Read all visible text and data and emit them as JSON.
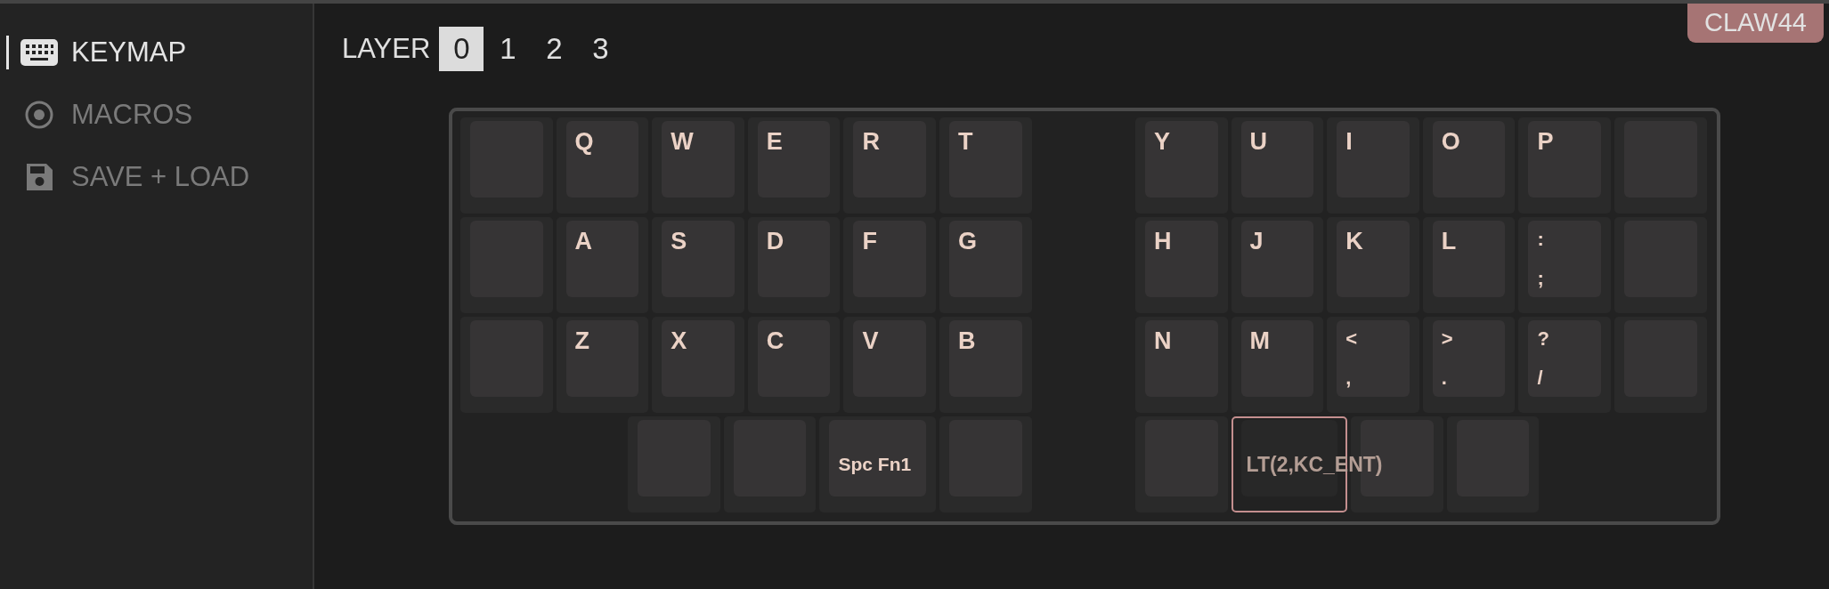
{
  "sidebar": {
    "items": [
      {
        "label": "KEYMAP",
        "selected": true
      },
      {
        "label": "MACROS",
        "selected": false
      },
      {
        "label": "SAVE + LOAD",
        "selected": false
      }
    ]
  },
  "layers": {
    "label": "LAYER",
    "tabs": [
      {
        "label": "0",
        "selected": true
      },
      {
        "label": "1",
        "selected": false
      },
      {
        "label": "2",
        "selected": false
      },
      {
        "label": "3",
        "selected": false
      }
    ]
  },
  "badge": "CLAW44",
  "keyboard": {
    "halves": [
      {
        "rows": [
          [
            {
              "kind": "blank",
              "selected": false
            },
            {
              "kind": "legend",
              "legends": [
                "Q"
              ],
              "selected": false
            },
            {
              "kind": "legend",
              "legends": [
                "W"
              ],
              "selected": false
            },
            {
              "kind": "legend",
              "legends": [
                "E"
              ],
              "selected": false
            },
            {
              "kind": "legend",
              "legends": [
                "R"
              ],
              "selected": false
            },
            {
              "kind": "legend",
              "legends": [
                "T"
              ],
              "selected": false
            }
          ],
          [
            {
              "kind": "blank",
              "selected": false
            },
            {
              "kind": "legend",
              "legends": [
                "A"
              ],
              "selected": false
            },
            {
              "kind": "legend",
              "legends": [
                "S"
              ],
              "selected": false
            },
            {
              "kind": "legend",
              "legends": [
                "D"
              ],
              "selected": false
            },
            {
              "kind": "legend",
              "legends": [
                "F"
              ],
              "selected": false
            },
            {
              "kind": "legend",
              "legends": [
                "G"
              ],
              "selected": false
            }
          ],
          [
            {
              "kind": "blank",
              "selected": false
            },
            {
              "kind": "legend",
              "legends": [
                "Z"
              ],
              "selected": false
            },
            {
              "kind": "legend",
              "legends": [
                "X"
              ],
              "selected": false
            },
            {
              "kind": "legend",
              "legends": [
                "C"
              ],
              "selected": false
            },
            {
              "kind": "legend",
              "legends": [
                "V"
              ],
              "selected": false
            },
            {
              "kind": "legend",
              "legends": [
                "B"
              ],
              "selected": false
            }
          ]
        ],
        "thumb_keys": [
          {
            "kind": "blank",
            "selected": false
          },
          {
            "kind": "blank",
            "selected": false
          },
          {
            "kind": "action",
            "label": "Spc Fn1",
            "selected": false
          },
          {
            "kind": "blank",
            "selected": false
          }
        ]
      },
      {
        "rows": [
          [
            {
              "kind": "legend",
              "legends": [
                "Y"
              ],
              "selected": false
            },
            {
              "kind": "legend",
              "legends": [
                "U"
              ],
              "selected": false
            },
            {
              "kind": "legend",
              "legends": [
                "I"
              ],
              "selected": false
            },
            {
              "kind": "legend",
              "legends": [
                "O"
              ],
              "selected": false
            },
            {
              "kind": "legend",
              "legends": [
                "P"
              ],
              "selected": false
            },
            {
              "kind": "blank",
              "selected": false
            }
          ],
          [
            {
              "kind": "legend",
              "legends": [
                "H"
              ],
              "selected": false
            },
            {
              "kind": "legend",
              "legends": [
                "J"
              ],
              "selected": false
            },
            {
              "kind": "legend",
              "legends": [
                "K"
              ],
              "selected": false
            },
            {
              "kind": "legend",
              "legends": [
                "L"
              ],
              "selected": false
            },
            {
              "kind": "legend",
              "legends": [
                ":",
                ";"
              ],
              "selected": false
            },
            {
              "kind": "blank",
              "selected": false
            }
          ],
          [
            {
              "kind": "legend",
              "legends": [
                "N"
              ],
              "selected": false
            },
            {
              "kind": "legend",
              "legends": [
                "M"
              ],
              "selected": false
            },
            {
              "kind": "legend",
              "legends": [
                "<",
                ","
              ],
              "selected": false
            },
            {
              "kind": "legend",
              "legends": [
                ">",
                "."
              ],
              "selected": false
            },
            {
              "kind": "legend",
              "legends": [
                "?",
                "/"
              ],
              "selected": false
            },
            {
              "kind": "blank",
              "selected": false
            }
          ]
        ],
        "thumb_keys": [
          {
            "kind": "blank",
            "selected": false
          },
          {
            "kind": "action",
            "label": "LT(2,KC_ENT)",
            "selected": true
          },
          {
            "kind": "blank",
            "selected": false
          },
          {
            "kind": "blank",
            "selected": false
          }
        ]
      }
    ]
  }
}
